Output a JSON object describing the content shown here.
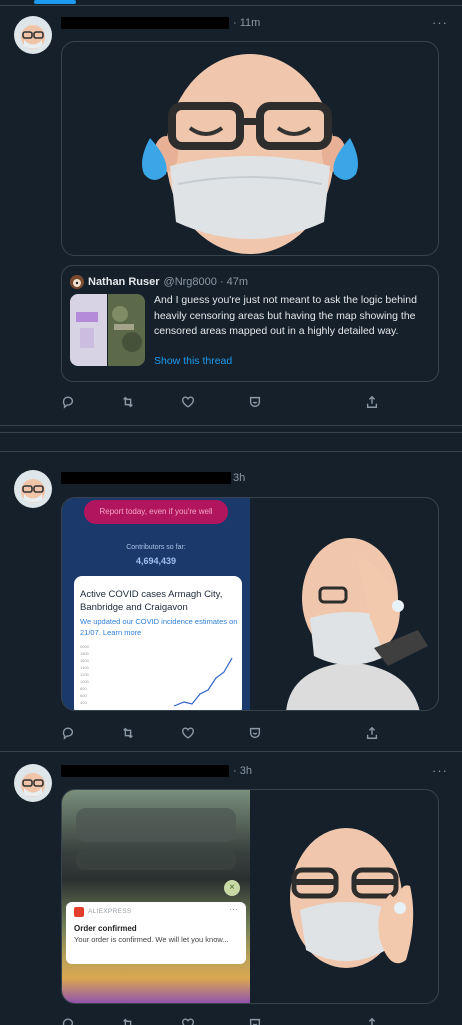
{
  "tweets": [
    {
      "time": "· 11m",
      "quote": {
        "name": "Nathan Ruser",
        "handle": "@Nrg8000 · 47m",
        "text": "And I guess you're just not meant to ask the logic behind heavily censoring areas but having the map showing the censored areas mapped out in a highly detailed way.",
        "show_thread": "Show this thread"
      }
    },
    {
      "time": "3h",
      "covid": {
        "report_button": "Report today, even if you're well",
        "contributors_label": "Contributors so far:",
        "contributors_count": "4,694,439",
        "card_title": "Active COVID cases Armagh City, Banbridge and Craigavon",
        "card_note": "We updated our COVID incidence estimates on 21/07. Learn more",
        "chart_ticks": [
          "2000",
          "1800",
          "1600",
          "1400",
          "1200",
          "1000",
          "800",
          "600",
          "400"
        ]
      }
    },
    {
      "time": "· 3h",
      "aliexpress": {
        "close": "×",
        "app_name": "ALIEXPRESS",
        "title": "Order confirmed",
        "body": "Your order is confirmed. We will let you know..."
      }
    }
  ],
  "more_icon_text": "···",
  "colors": {
    "background": "#15202b",
    "border": "#38444d",
    "accent": "#1d9bf0",
    "muted": "#8b98a5"
  }
}
